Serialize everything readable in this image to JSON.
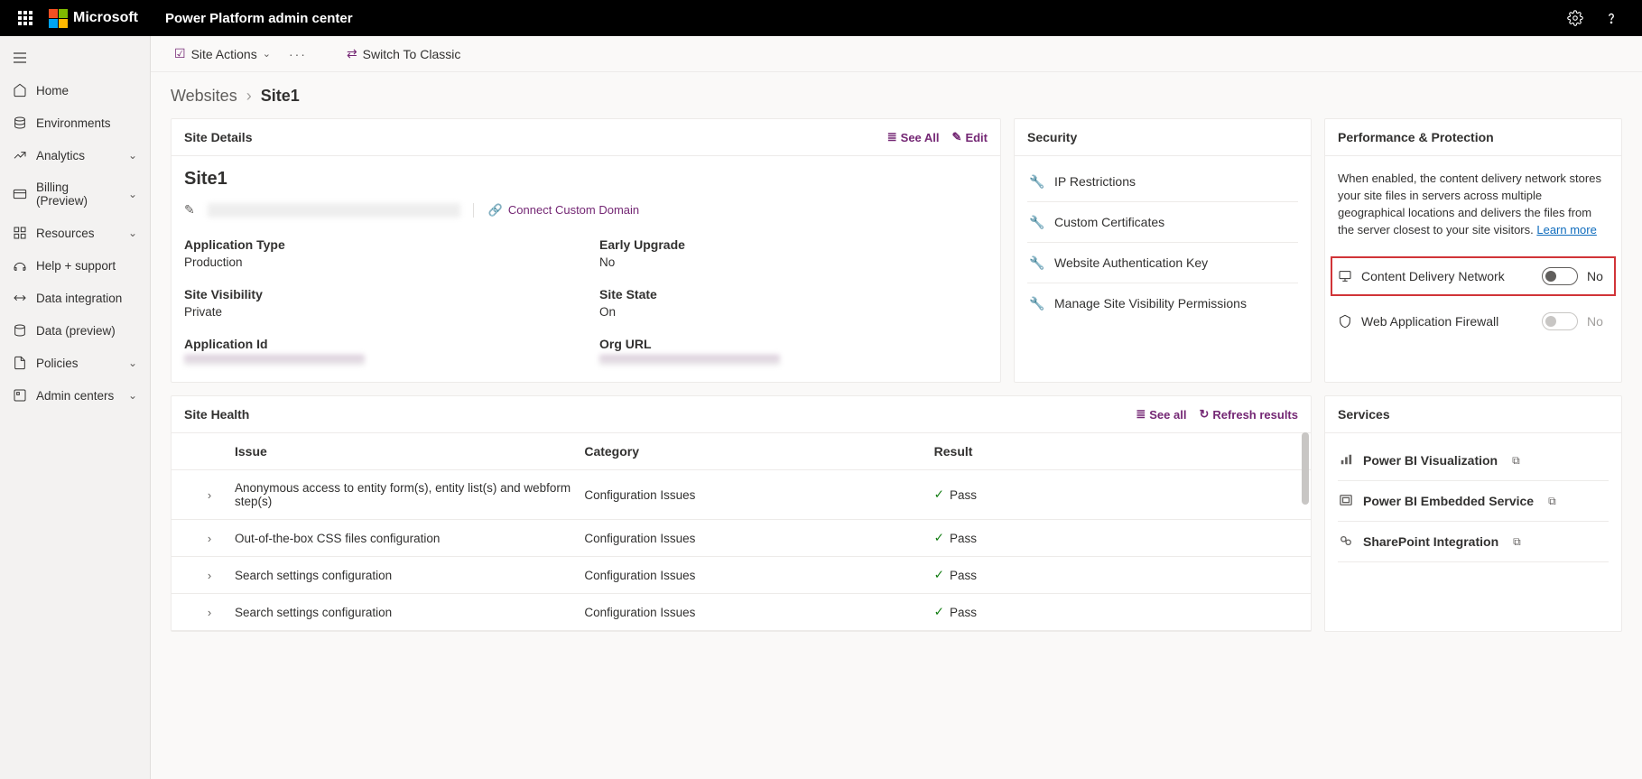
{
  "header": {
    "brand": "Microsoft",
    "app_title": "Power Platform admin center"
  },
  "sidebar": {
    "items": [
      {
        "label": "Home"
      },
      {
        "label": "Environments"
      },
      {
        "label": "Analytics",
        "expandable": true
      },
      {
        "label": "Billing (Preview)",
        "expandable": true
      },
      {
        "label": "Resources",
        "expandable": true
      },
      {
        "label": "Help + support"
      },
      {
        "label": "Data integration"
      },
      {
        "label": "Data (preview)"
      },
      {
        "label": "Policies",
        "expandable": true
      },
      {
        "label": "Admin centers",
        "expandable": true
      }
    ]
  },
  "command_bar": {
    "site_actions": "Site Actions",
    "switch_classic": "Switch To Classic"
  },
  "breadcrumb": {
    "parent": "Websites",
    "current": "Site1"
  },
  "site_details": {
    "card_title": "Site Details",
    "see_all": "See All",
    "edit": "Edit",
    "site_name": "Site1",
    "connect_domain": "Connect Custom Domain",
    "fields": {
      "application_type": {
        "label": "Application Type",
        "value": "Production"
      },
      "early_upgrade": {
        "label": "Early Upgrade",
        "value": "No"
      },
      "site_visibility": {
        "label": "Site Visibility",
        "value": "Private"
      },
      "site_state": {
        "label": "Site State",
        "value": "On"
      },
      "application_id": {
        "label": "Application Id",
        "value": ""
      },
      "org_url": {
        "label": "Org URL",
        "value": ""
      }
    }
  },
  "security": {
    "card_title": "Security",
    "items": [
      "IP Restrictions",
      "Custom Certificates",
      "Website Authentication Key",
      "Manage Site Visibility Permissions"
    ]
  },
  "performance": {
    "card_title": "Performance & Protection",
    "description": "When enabled, the content delivery network stores your site files in servers across multiple geographical locations and delivers the files from the server closest to your site visitors. ",
    "learn_more": "Learn more",
    "cdn": {
      "label": "Content Delivery Network",
      "state": "No"
    },
    "waf": {
      "label": "Web Application Firewall",
      "state": "No"
    }
  },
  "site_health": {
    "card_title": "Site Health",
    "see_all": "See all",
    "refresh": "Refresh results",
    "columns": {
      "issue": "Issue",
      "category": "Category",
      "result": "Result"
    },
    "rows": [
      {
        "issue": "Anonymous access to entity form(s), entity list(s) and webform step(s)",
        "category": "Configuration Issues",
        "result": "Pass"
      },
      {
        "issue": "Out-of-the-box CSS files configuration",
        "category": "Configuration Issues",
        "result": "Pass"
      },
      {
        "issue": "Search settings configuration",
        "category": "Configuration Issues",
        "result": "Pass"
      },
      {
        "issue": "Search settings configuration",
        "category": "Configuration Issues",
        "result": "Pass"
      }
    ]
  },
  "services": {
    "card_title": "Services",
    "items": [
      "Power BI Visualization",
      "Power BI Embedded Service",
      "SharePoint Integration"
    ]
  }
}
